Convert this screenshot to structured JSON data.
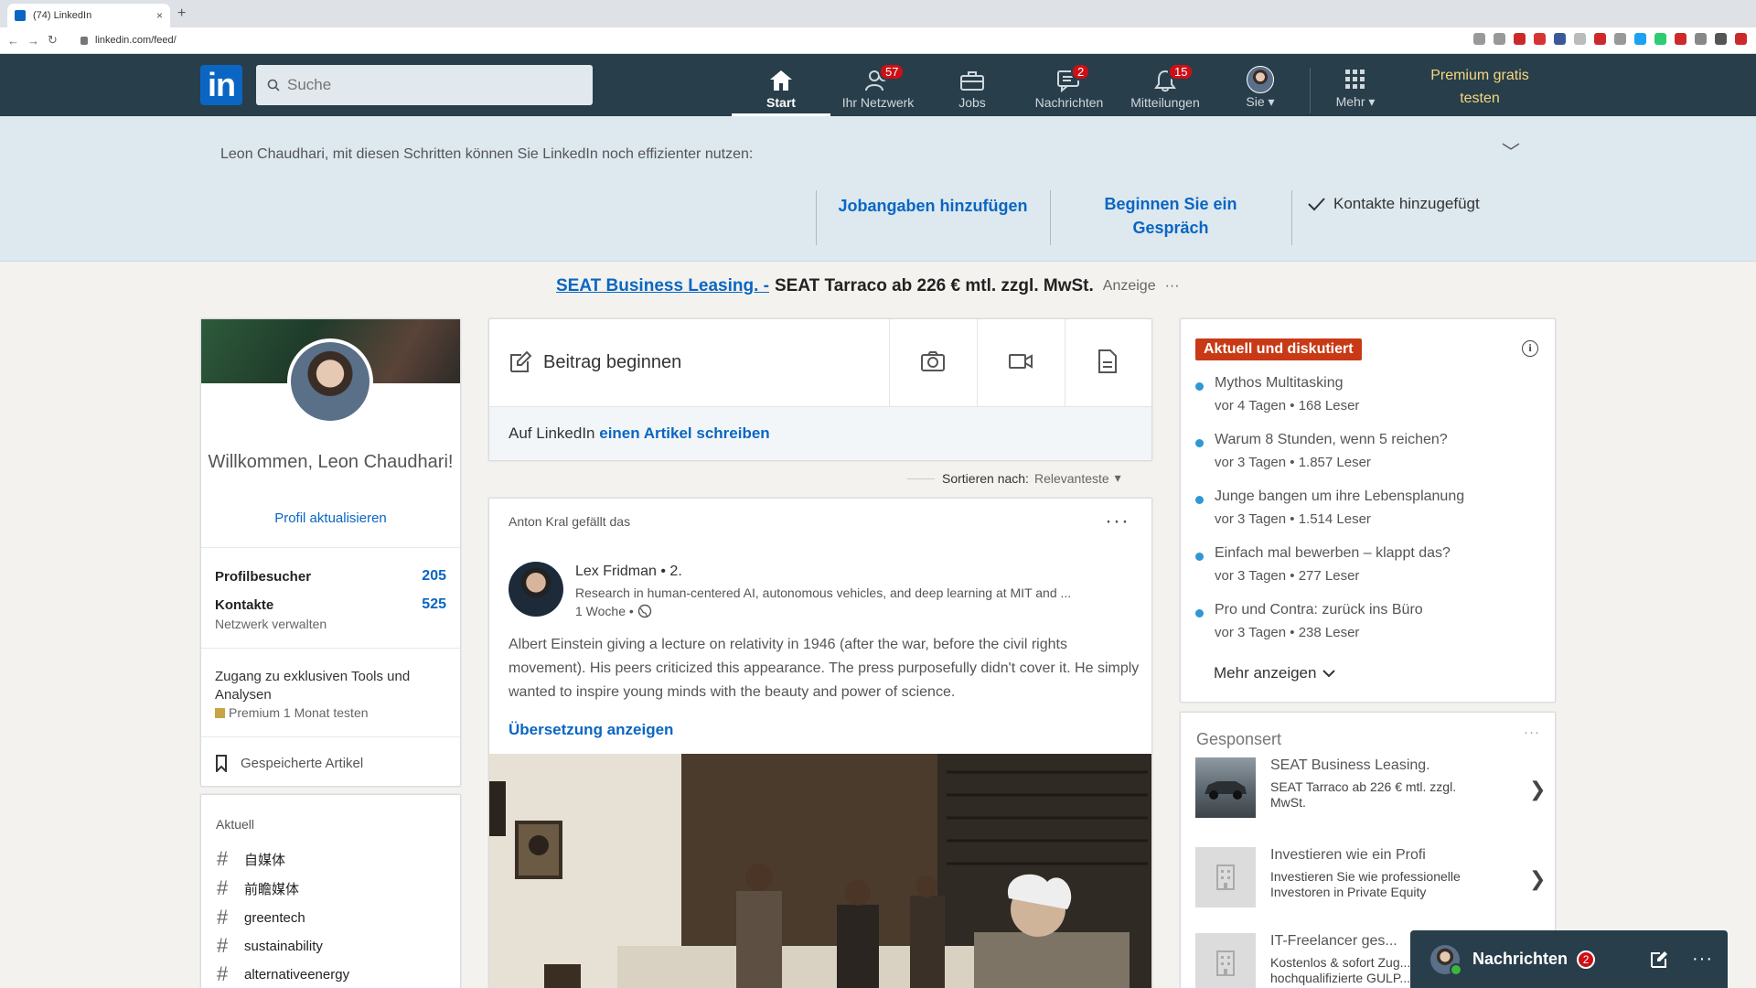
{
  "browser": {
    "tab_title": "(74) LinkedIn",
    "tab_close": "×",
    "new_tab": "+",
    "url": "linkedin.com/feed/",
    "extension_colors": [
      "#999",
      "#999",
      "#cc2a2a",
      "#d83333",
      "#3b5998",
      "#bbb",
      "#cc2a2a",
      "#999",
      "#1da1f2",
      "#2ecc71",
      "#cc2a2a",
      "#888",
      "#555",
      "#cc2a2a"
    ]
  },
  "header": {
    "logo": "in",
    "search_placeholder": "Suche",
    "nav": [
      {
        "label": "Start",
        "icon": "home-icon",
        "badge": ""
      },
      {
        "label": "Ihr Netzwerk",
        "icon": "network-icon",
        "badge": "57"
      },
      {
        "label": "Jobs",
        "icon": "briefcase-icon",
        "badge": ""
      },
      {
        "label": "Nachrichten",
        "icon": "messages-icon",
        "badge": "2"
      },
      {
        "label": "Mitteilungen",
        "icon": "bell-icon",
        "badge": "15"
      },
      {
        "label": "Sie",
        "icon": "avatar-icon",
        "badge": ""
      },
      {
        "label": "Mehr",
        "icon": "grid-icon",
        "badge": ""
      }
    ],
    "premium_line1": "Premium gratis",
    "premium_line2": "testen",
    "colors": {
      "bar": "#283e4a",
      "premium": "#f5d77f",
      "badge": "#cc1016"
    }
  },
  "onboarding": {
    "text": "Leon Chaudhari, mit diesen Schritten können Sie LinkedIn noch effizienter nutzen:",
    "actions": [
      "Jobangaben hinzufügen",
      "Beginnen Sie ein Gespräch"
    ],
    "done": "Kontakte hinzugefügt"
  },
  "ad": {
    "link": "SEAT Business Leasing. -",
    "text": "SEAT Tarraco ab 226 € mtl. zzgl. MwSt.",
    "tag": "Anzeige",
    "more": "···"
  },
  "profile": {
    "welcome": "Willkommen, Leon Chaudhari!",
    "update": "Profil aktualisieren",
    "visitors_label": "Profilbesucher",
    "visitors_value": "205",
    "contacts_label": "Kontakte",
    "contacts_value": "525",
    "contacts_sub": "Netzwerk verwalten",
    "premium_text": "Zugang zu exklusiven Tools und Analysen",
    "premium_cta": "Premium 1 Monat testen",
    "saved": "Gespeicherte Artikel"
  },
  "tags": {
    "title": "Aktuell",
    "items": [
      "自媒体",
      "前瞻媒体",
      "greentech",
      "sustainability",
      "alternativeenergy"
    ]
  },
  "share": {
    "start": "Beitrag beginnen",
    "article_prefix": "Auf LinkedIn",
    "article_link": "einen Artikel schreiben"
  },
  "sort": {
    "label": "Sortieren nach:",
    "value": "Relevanteste"
  },
  "post": {
    "liked_name": "Anton Kral",
    "liked_suffix": "gefällt das",
    "menu": "···",
    "author": "Lex Fridman",
    "degree": "• 2.",
    "headline": "Research in human-centered AI, autonomous vehicles, and deep learning at MIT and ...",
    "time": "1 Woche •",
    "text": "Albert Einstein giving a lecture on relativity in 1946 (after the war, before the civil rights movement). His peers criticized this appearance. The press purposefully didn't cover it. He simply wanted to inspire young minds with the beauty and power of science.",
    "translate": "Übersetzung anzeigen"
  },
  "news": {
    "badge": "Aktuell und diskutiert",
    "info": "i",
    "items": [
      {
        "title": "Mythos Multitasking",
        "meta": "vor 4 Tagen • 168 Leser"
      },
      {
        "title": "Warum 8 Stunden, wenn 5 reichen?",
        "meta": "vor 3 Tagen • 1.857 Leser"
      },
      {
        "title": "Junge bangen um ihre Lebensplanung",
        "meta": "vor 3 Tagen • 1.514 Leser"
      },
      {
        "title": "Einfach mal bewerben – klappt das?",
        "meta": "vor 3 Tagen • 277 Leser"
      },
      {
        "title": "Pro und Contra: zurück ins Büro",
        "meta": "vor 3 Tagen • 238 Leser"
      }
    ],
    "more": "Mehr anzeigen",
    "dot_color": "#2f97d1",
    "badge_color": "#c83a16"
  },
  "sponsored": {
    "title": "Gesponsert",
    "menu": "···",
    "items": [
      {
        "title": "SEAT Business Leasing.",
        "desc": "SEAT Tarraco ab 226 € mtl. zzgl. MwSt."
      },
      {
        "title": "Investieren wie ein Profi",
        "desc": "Investieren Sie wie professionelle Investoren in Private Equity"
      },
      {
        "title": "IT-Freelancer ges...",
        "desc": "Kostenlos & sofort Zug... hochqualifizierte GULP..."
      }
    ]
  },
  "messaging": {
    "label": "Nachrichten",
    "count": "2",
    "more": "···"
  }
}
